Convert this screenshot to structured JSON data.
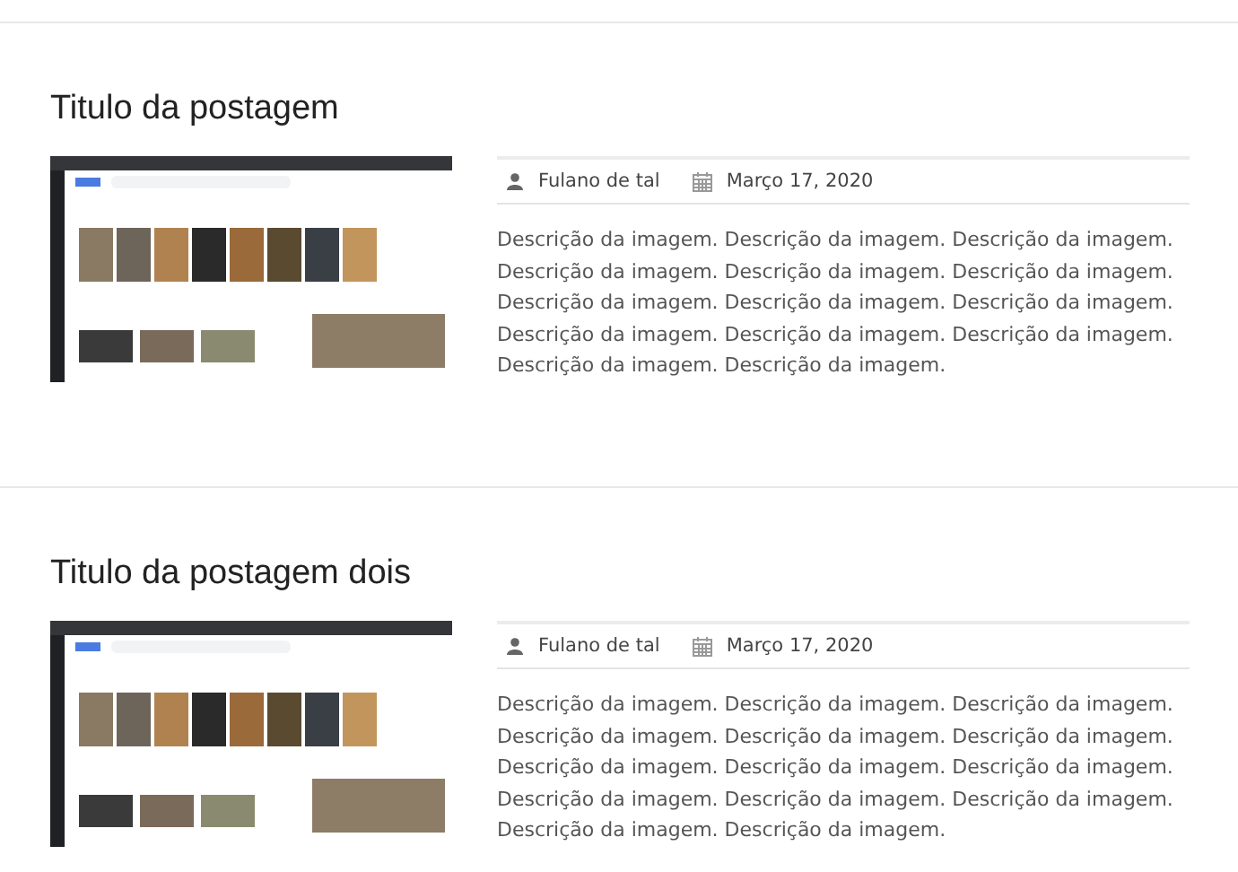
{
  "posts": [
    {
      "title": "Titulo da postagem",
      "author": "Fulano de tal",
      "date": "Março 17, 2020",
      "description": "Descrição da imagem. Descrição da imagem. Descrição da imagem. Descrição da imagem. Descrição da imagem. Descrição da imagem. Descrição da imagem. Descrição da imagem. Descrição da imagem. Descrição da imagem. Descrição da imagem. Descrição da imagem. Descrição da imagem. Descrição da imagem."
    },
    {
      "title": "Titulo da postagem dois",
      "author": "Fulano de tal",
      "date": "Março 17, 2020",
      "description": "Descrição da imagem. Descrição da imagem. Descrição da imagem. Descrição da imagem. Descrição da imagem. Descrição da imagem. Descrição da imagem. Descrição da imagem. Descrição da imagem. Descrição da imagem. Descrição da imagem. Descrição da imagem. Descrição da imagem. Descrição da imagem."
    }
  ]
}
